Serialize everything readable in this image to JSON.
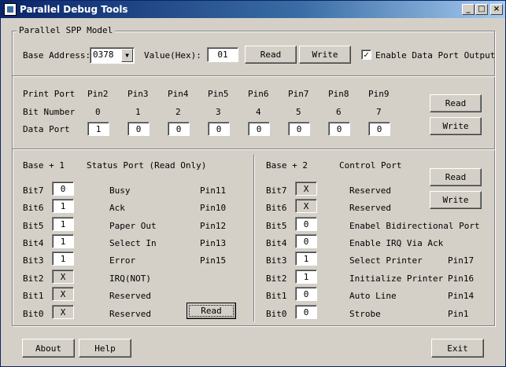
{
  "window": {
    "title": "Parallel Debug Tools",
    "controls": [
      "_",
      "□",
      "×"
    ]
  },
  "group": {
    "legend": "Parallel SPP Model"
  },
  "top": {
    "base_address_label": "Base Address:",
    "base_address_value": "0378",
    "value_label": "Value(Hex):",
    "value_value": "01",
    "read_label": "Read",
    "write_label": "Write",
    "enable_checked": "✓",
    "enable_label": "Enable Data Port Output"
  },
  "data_port": {
    "row_labels": [
      "Print Port",
      "Bit Number",
      "Data Port"
    ],
    "pins": [
      "Pin2",
      "Pin3",
      "Pin4",
      "Pin5",
      "Pin6",
      "Pin7",
      "Pin8",
      "Pin9"
    ],
    "bits": [
      "0",
      "1",
      "2",
      "3",
      "4",
      "5",
      "6",
      "7"
    ],
    "values": [
      "1",
      "0",
      "0",
      "0",
      "0",
      "0",
      "0",
      "0"
    ],
    "read_label": "Read",
    "write_label": "Write"
  },
  "status": {
    "base_label": "Base + 1",
    "title": "Status Port (Read Only)",
    "read_label": "Read",
    "rows": [
      {
        "bit": "Bit7",
        "value": "0",
        "name": "Busy",
        "pin": "Pin11"
      },
      {
        "bit": "Bit6",
        "value": "1",
        "name": "Ack",
        "pin": "Pin10"
      },
      {
        "bit": "Bit5",
        "value": "1",
        "name": "Paper Out",
        "pin": "Pin12"
      },
      {
        "bit": "Bit4",
        "value": "1",
        "name": "Select In",
        "pin": "Pin13"
      },
      {
        "bit": "Bit3",
        "value": "1",
        "name": "Error",
        "pin": "Pin15"
      },
      {
        "bit": "Bit2",
        "value": "X",
        "name": "IRQ(NOT)",
        "pin": ""
      },
      {
        "bit": "Bit1",
        "value": "X",
        "name": "Reserved",
        "pin": ""
      },
      {
        "bit": "Bit0",
        "value": "X",
        "name": "Reserved",
        "pin": ""
      }
    ]
  },
  "control": {
    "base_label": "Base + 2",
    "title": "Control Port",
    "read_label": "Read",
    "write_label": "Write",
    "rows": [
      {
        "bit": "Bit7",
        "value": "X",
        "name": "Reserved",
        "pin": ""
      },
      {
        "bit": "Bit6",
        "value": "X",
        "name": "Reserved",
        "pin": ""
      },
      {
        "bit": "Bit5",
        "value": "0",
        "name": "Enabel Bidirectional Port",
        "pin": ""
      },
      {
        "bit": "Bit4",
        "value": "0",
        "name": "Enable IRQ Via Ack",
        "pin": ""
      },
      {
        "bit": "Bit3",
        "value": "1",
        "name": "Select Printer",
        "pin": "Pin17"
      },
      {
        "bit": "Bit2",
        "value": "1",
        "name": "Initialize Printer",
        "pin": "Pin16"
      },
      {
        "bit": "Bit1",
        "value": "0",
        "name": "Auto Line",
        "pin": "Pin14"
      },
      {
        "bit": "Bit0",
        "value": "0",
        "name": "Strobe",
        "pin": "Pin1"
      }
    ]
  },
  "bottom": {
    "about_label": "About",
    "help_label": "Help",
    "exit_label": "Exit"
  }
}
